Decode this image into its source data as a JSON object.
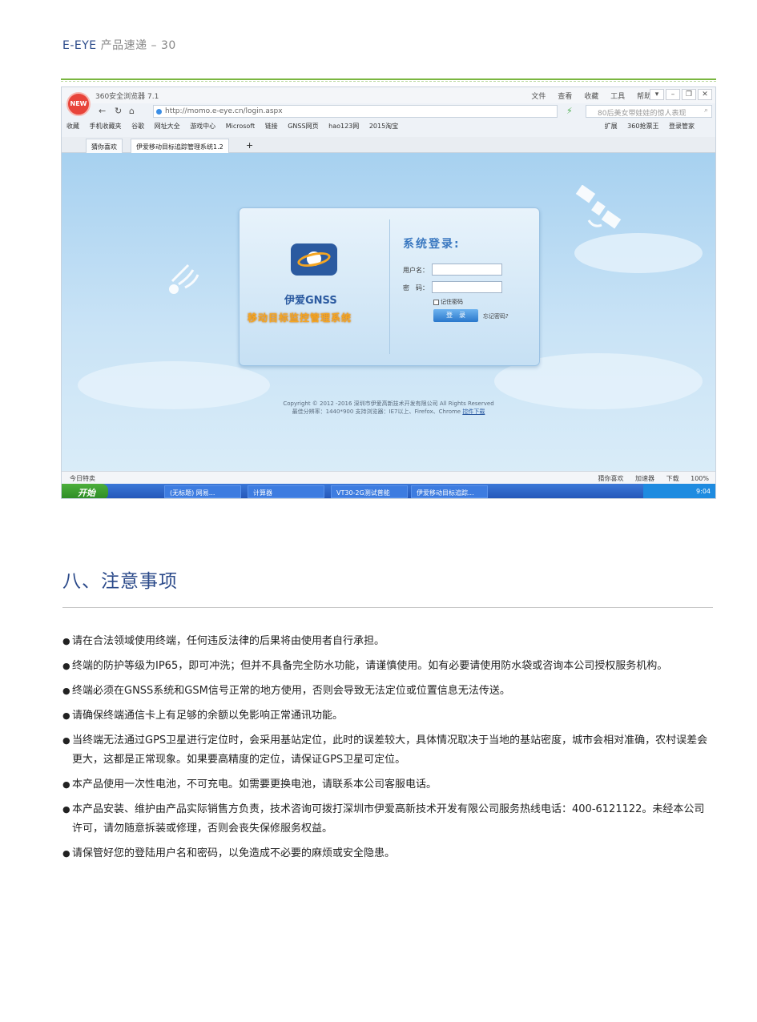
{
  "header": {
    "brand": "E-EYE",
    "subtitle": "产品速递 – 30"
  },
  "screenshot": {
    "browser_title": "360安全浏览器 7.1",
    "menu": [
      "文件",
      "查看",
      "收藏",
      "工具",
      "帮助"
    ],
    "new_badge": "NEW",
    "url": "http://momo.e-eye.cn/login.aspx",
    "search_placeholder": "80后美女带娃娃的惊人表现",
    "favorites": [
      "收藏",
      "手机收藏夹",
      "谷歌",
      "网址大全",
      "游戏中心",
      "Microsoft",
      "链接",
      "GNSS网页",
      "hao123网",
      "2015淘宝"
    ],
    "favorites_right": [
      "扩展",
      "360抢票王",
      "登录管家"
    ],
    "tabs": [
      "猜你喜欢",
      "伊爱移动目标追踪管理系统1.2"
    ],
    "login": {
      "brand_name": "伊爱GNSS",
      "brand_sub": "移动目标监控管理系统",
      "heading": "系统登录:",
      "username_label": "用户名：",
      "password_label": "密　码：",
      "remember": "记住密码",
      "button": "登　录",
      "forgot": "忘记密码?"
    },
    "copyright_line1": "Copyright © 2012 -2016 深圳市伊爱高新技术开发有限公司 All Rights Reserved",
    "copyright_line2": "最佳分辨率：1440*900  支持浏览器：IE7以上、Firefox、Chrome",
    "copyright_link": "控件下载",
    "status_left": "今日特卖",
    "status_right": [
      "猜你喜欢",
      "加速器",
      "下载",
      "100%"
    ],
    "start_label": "开始",
    "task_items": [
      "(无标题) 网易...",
      "计算器",
      "VT30-2G测试普能",
      "伊爱移动目标追踪..."
    ],
    "clock": "9:04"
  },
  "section": {
    "title": "八、注意事项"
  },
  "notes": [
    "请在合法领域使用终端，任何违反法律的后果将由使用者自行承担。",
    "终端的防护等级为IP65，即可冲洗；但并不具备完全防水功能，请谨慎使用。如有必要请使用防水袋或咨询本公司授权服务机构。",
    "终端必须在GNSS系统和GSM信号正常的地方使用，否则会导致无法定位或位置信息无法传送。",
    "请确保终端通信卡上有足够的余额以免影响正常通讯功能。",
    "当终端无法通过GPS卫星进行定位时，会采用基站定位，此时的误差较大，具体情况取决于当地的基站密度，城市会相对准确，农村误差会更大，这都是正常现象。如果要高精度的定位，请保证GPS卫星可定位。",
    "本产品使用一次性电池，不可充电。如需要更换电池，请联系本公司客服电话。",
    "本产品安装、维护由产品实际销售方负责，技术咨询可拨打深圳市伊爱高新技术开发有限公司服务热线电话：400-6121122。未经本公司许可，请勿随意拆装或修理，否则会丧失保修服务权益。",
    "请保管好您的登陆用户名和密码，以免造成不必要的麻烦或安全隐患。"
  ]
}
